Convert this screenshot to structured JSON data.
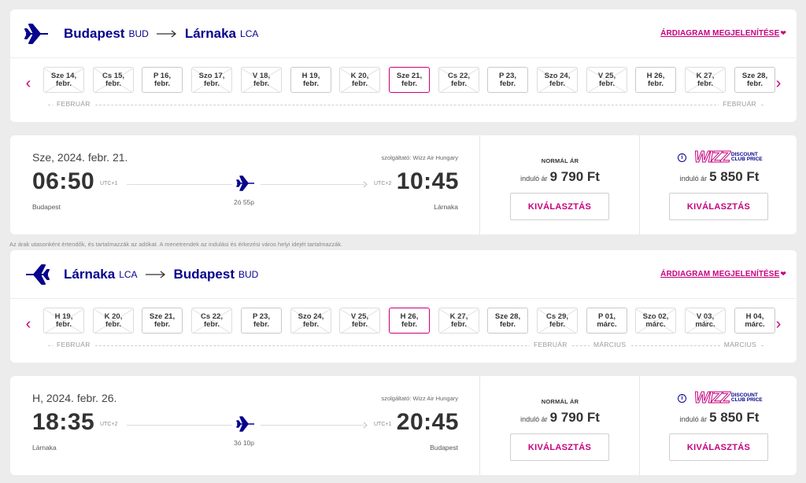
{
  "outbound": {
    "route": {
      "from_city": "Budapest",
      "from_code": "BUD",
      "to_city": "Lárnaka",
      "to_code": "LCA",
      "chart_link": "ÁRDIAGRAM MEGJELENÍTÉSE"
    },
    "days": [
      {
        "l1": "Sze 14,",
        "l2": "febr.",
        "available": false
      },
      {
        "l1": "Cs 15,",
        "l2": "febr.",
        "available": false
      },
      {
        "l1": "P 16,",
        "l2": "febr.",
        "available": true
      },
      {
        "l1": "Szo 17,",
        "l2": "febr.",
        "available": false
      },
      {
        "l1": "V 18,",
        "l2": "febr.",
        "available": false
      },
      {
        "l1": "H 19,",
        "l2": "febr.",
        "available": true
      },
      {
        "l1": "K 20,",
        "l2": "febr.",
        "available": false
      },
      {
        "l1": "Sze 21,",
        "l2": "febr.",
        "available": true,
        "selected": true
      },
      {
        "l1": "Cs 22,",
        "l2": "febr.",
        "available": false
      },
      {
        "l1": "P 23,",
        "l2": "febr.",
        "available": true
      },
      {
        "l1": "Szo 24,",
        "l2": "febr.",
        "available": false
      },
      {
        "l1": "V 25,",
        "l2": "febr.",
        "available": false
      },
      {
        "l1": "H 26,",
        "l2": "febr.",
        "available": true
      },
      {
        "l1": "K 27,",
        "l2": "febr.",
        "available": false
      },
      {
        "l1": "Sze 28,",
        "l2": "febr.",
        "available": true
      }
    ],
    "months": {
      "left": "FEBRUÁR",
      "right": "FEBRUÁR"
    },
    "flight": {
      "date": "Sze, 2024. febr. 21.",
      "operator": "szolgáltató: Wizz Air Hungary",
      "dep_time": "06:50",
      "dep_tz": "UTC+1",
      "dep_city": "Budapest",
      "arr_time": "10:45",
      "arr_tz": "UTC+2",
      "arr_city": "Lárnaka",
      "duration": "2ó 55p"
    },
    "normal": {
      "title": "NORMÁL ÁR",
      "from": "induló ár",
      "price": "9 790 Ft",
      "button": "KIVÁLASZTÁS"
    },
    "club": {
      "wizz": "WIZZ",
      "title_line1": "DISCOUNT",
      "title_line2": "CLUB PRICE",
      "from": "induló ár",
      "price": "5 850 Ft",
      "button": "KIVÁLASZTÁS"
    }
  },
  "disclaimer": "Az árak utasonként értendők, és tartalmazzák az adókat. A menetrendek az indulási és érkezési város helyi idejét tartalmazzák.",
  "return": {
    "route": {
      "from_city": "Lárnaka",
      "from_code": "LCA",
      "to_city": "Budapest",
      "to_code": "BUD",
      "chart_link": "ÁRDIAGRAM MEGJELENÍTÉSE"
    },
    "days": [
      {
        "l1": "H 19,",
        "l2": "febr.",
        "available": false
      },
      {
        "l1": "K 20,",
        "l2": "febr.",
        "available": false
      },
      {
        "l1": "Sze 21,",
        "l2": "febr.",
        "available": true
      },
      {
        "l1": "Cs 22,",
        "l2": "febr.",
        "available": false
      },
      {
        "l1": "P 23,",
        "l2": "febr.",
        "available": true
      },
      {
        "l1": "Szo 24,",
        "l2": "febr.",
        "available": false
      },
      {
        "l1": "V 25,",
        "l2": "febr.",
        "available": false
      },
      {
        "l1": "H 26,",
        "l2": "febr.",
        "available": true,
        "selected": true
      },
      {
        "l1": "K 27,",
        "l2": "febr.",
        "available": false
      },
      {
        "l1": "Sze 28,",
        "l2": "febr.",
        "available": true
      },
      {
        "l1": "Cs 29,",
        "l2": "febr.",
        "available": false
      },
      {
        "l1": "P 01,",
        "l2": "márc.",
        "available": true
      },
      {
        "l1": "Szo 02,",
        "l2": "márc.",
        "available": false
      },
      {
        "l1": "V 03,",
        "l2": "márc.",
        "available": false
      },
      {
        "l1": "H 04,",
        "l2": "márc.",
        "available": true
      }
    ],
    "months": {
      "left": "FEBRUÁR",
      "mid_left": "FEBRUÁR",
      "mid_right": "MÁRCIUS",
      "right": "MÁRCIUS"
    },
    "flight": {
      "date": "H, 2024. febr. 26.",
      "operator": "szolgáltató: Wizz Air Hungary",
      "dep_time": "18:35",
      "dep_tz": "UTC+2",
      "dep_city": "Lárnaka",
      "arr_time": "20:45",
      "arr_tz": "UTC+1",
      "arr_city": "Budapest",
      "duration": "3ó 10p"
    },
    "normal": {
      "title": "NORMÁL ÁR",
      "from": "induló ár",
      "price": "9 790 Ft",
      "button": "KIVÁLASZTÁS"
    },
    "club": {
      "wizz": "WIZZ",
      "title_line1": "DISCOUNT",
      "title_line2": "CLUB PRICE",
      "from": "induló ár",
      "price": "5 850 Ft",
      "button": "KIVÁLASZTÁS"
    }
  },
  "colors": {
    "brand_blue": "#06038d",
    "brand_pink": "#c6007e"
  }
}
